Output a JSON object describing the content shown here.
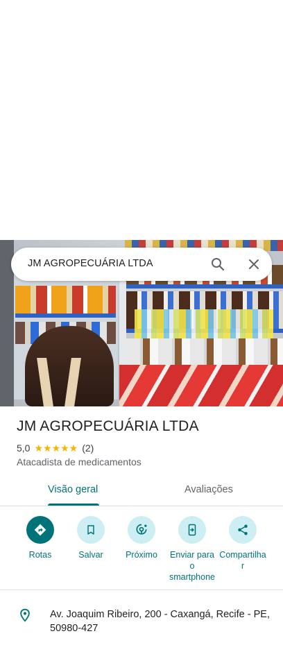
{
  "search": {
    "query": "JM AGROPECUÁRIA LTDA"
  },
  "place": {
    "title": "JM AGROPECUÁRIA LTDA",
    "rating": "5,0",
    "stars": "★★★★★",
    "review_count": "(2)",
    "category": "Atacadista de medicamentos"
  },
  "tabs": [
    {
      "label": "Visão geral",
      "selected": true
    },
    {
      "label": "Avaliações",
      "selected": false
    }
  ],
  "actions": [
    {
      "label": "Rotas",
      "icon": "directions-icon"
    },
    {
      "label": "Salvar",
      "icon": "bookmark-icon"
    },
    {
      "label": "Próximo",
      "icon": "nearby-icon"
    },
    {
      "label": "Enviar para o smartphone",
      "icon": "send-to-phone-icon"
    },
    {
      "label": "Compartilhar",
      "icon": "share-icon"
    }
  ],
  "info": {
    "address": "Av. Joaquim Ribeiro, 200 - Caxangá, Recife - PE, 50980-427",
    "icon": "location-pin-icon"
  },
  "colors": {
    "accent": "#00737a",
    "chip_bg": "#cdeef3",
    "star": "#f4b400",
    "text": "#202124",
    "secondary_text": "#5f6368"
  }
}
